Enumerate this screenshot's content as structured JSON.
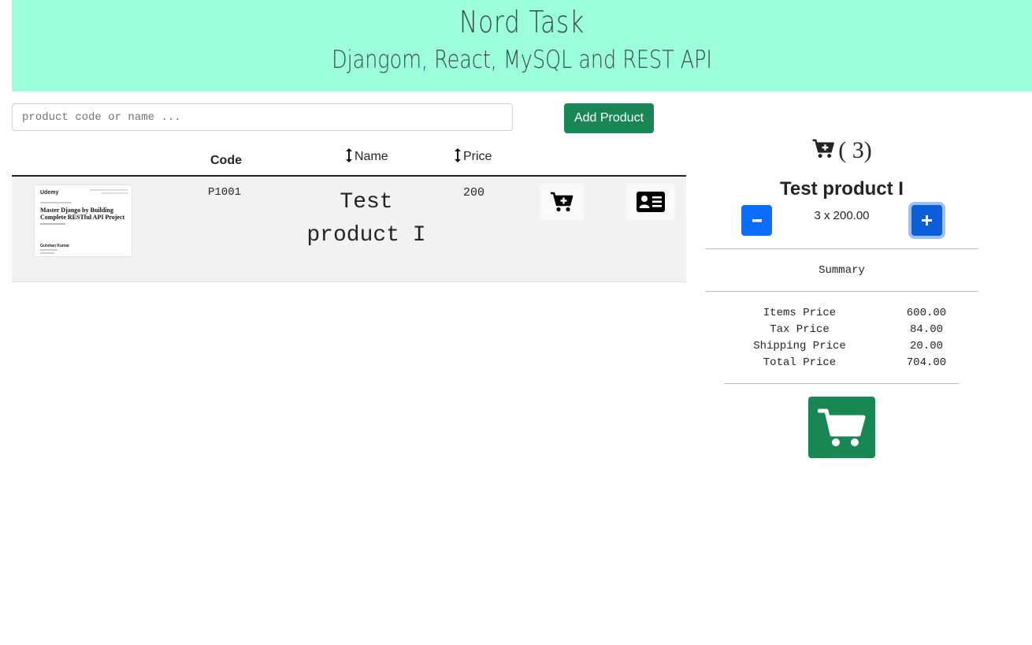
{
  "header": {
    "title": "Nord Task",
    "subtitle": "Djangom, React, MySQL and REST API",
    "background": "#9bffdc"
  },
  "toolbar": {
    "search_placeholder": "product code or name ...",
    "search_value": "",
    "add_label": "Add Product"
  },
  "table": {
    "columns": {
      "code": "Code",
      "name": "Name",
      "price": "Price"
    },
    "rows": [
      {
        "thumbnail": {
          "brand": "Udemy",
          "course_title": "Master Django by Building Complete RESTful API Project",
          "author": "Gulshan Kumar"
        },
        "code": "P1001",
        "name": "Test product I",
        "price": "200",
        "add_icon": "cart-plus-icon",
        "details_icon": "id-card-icon"
      }
    ]
  },
  "cart": {
    "icon": "cart-plus-icon",
    "count_label": "( 3)",
    "item": {
      "name": "Test product I",
      "qty_text": "3 x 200.00",
      "minus_label": "−",
      "plus_label": "+"
    },
    "summary_label": "Summary",
    "summary": [
      {
        "key": "Items Price",
        "value": "600.00"
      },
      {
        "key": "Tax Price",
        "value": "84.00"
      },
      {
        "key": "Shipping Price",
        "value": "20.00"
      },
      {
        "key": "Total Price",
        "value": "704.00"
      }
    ],
    "checkout_icon": "shopping-cart-icon"
  },
  "colors": {
    "success": "#198754",
    "primary": "#0d6efd",
    "row_bg": "#f2f2f2"
  }
}
